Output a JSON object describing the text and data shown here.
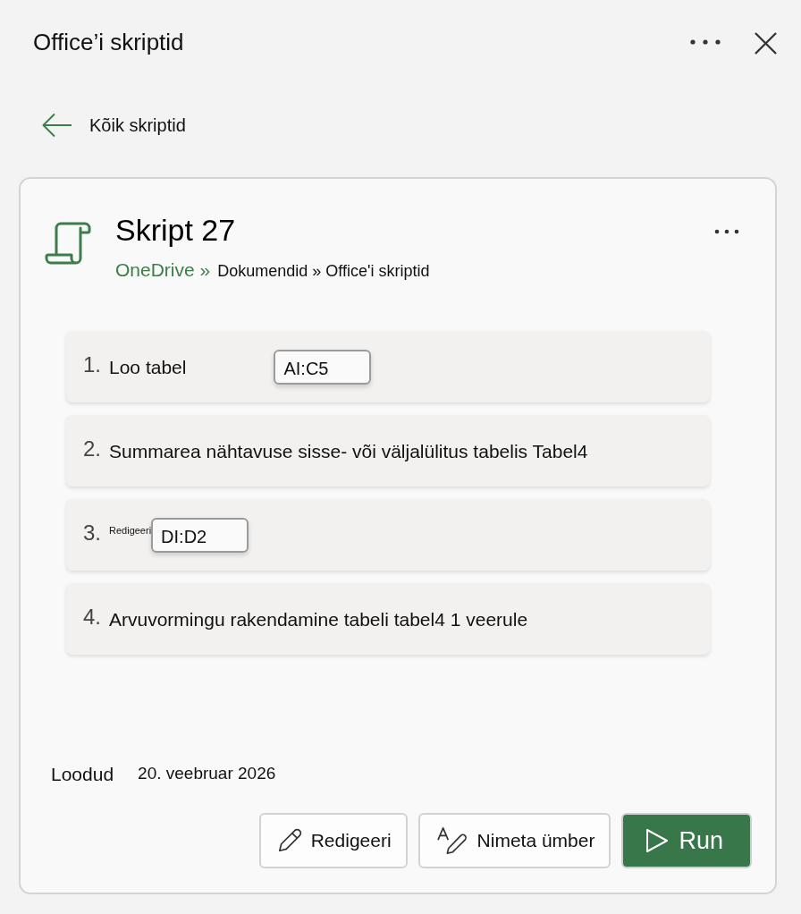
{
  "header": {
    "title": "Office’i skriptid"
  },
  "back_link": {
    "label": "Kõik skriptid"
  },
  "script": {
    "name": "Skript 27",
    "breadcrumb": [
      {
        "label": "OneDrive »",
        "kind": "link"
      },
      {
        "label": "Dokumendid » Office'i skriptid",
        "kind": "path"
      }
    ]
  },
  "steps": [
    {
      "number": "1.",
      "text": "Loo tabel",
      "field": {
        "value": "AI:C5"
      }
    },
    {
      "number": "2.",
      "text": "Summarea nähtavuse sisse- või väljalülitus tabelis Tabel4"
    },
    {
      "number": "3.",
      "caption": "Redigeeri",
      "field": {
        "value": "DI:D2"
      }
    },
    {
      "number": "4.",
      "text": "Arvuvormingu rakendamine tabeli tabel4 1 veerule"
    }
  ],
  "created": {
    "label": "Loodud",
    "value": "20. veebruar 2026"
  },
  "buttons": [
    {
      "label": "Redigeeri",
      "kind": "edit"
    },
    {
      "label": "Nimeta ümber",
      "kind": "rename"
    },
    {
      "label": "Run",
      "kind": "run"
    }
  ]
}
